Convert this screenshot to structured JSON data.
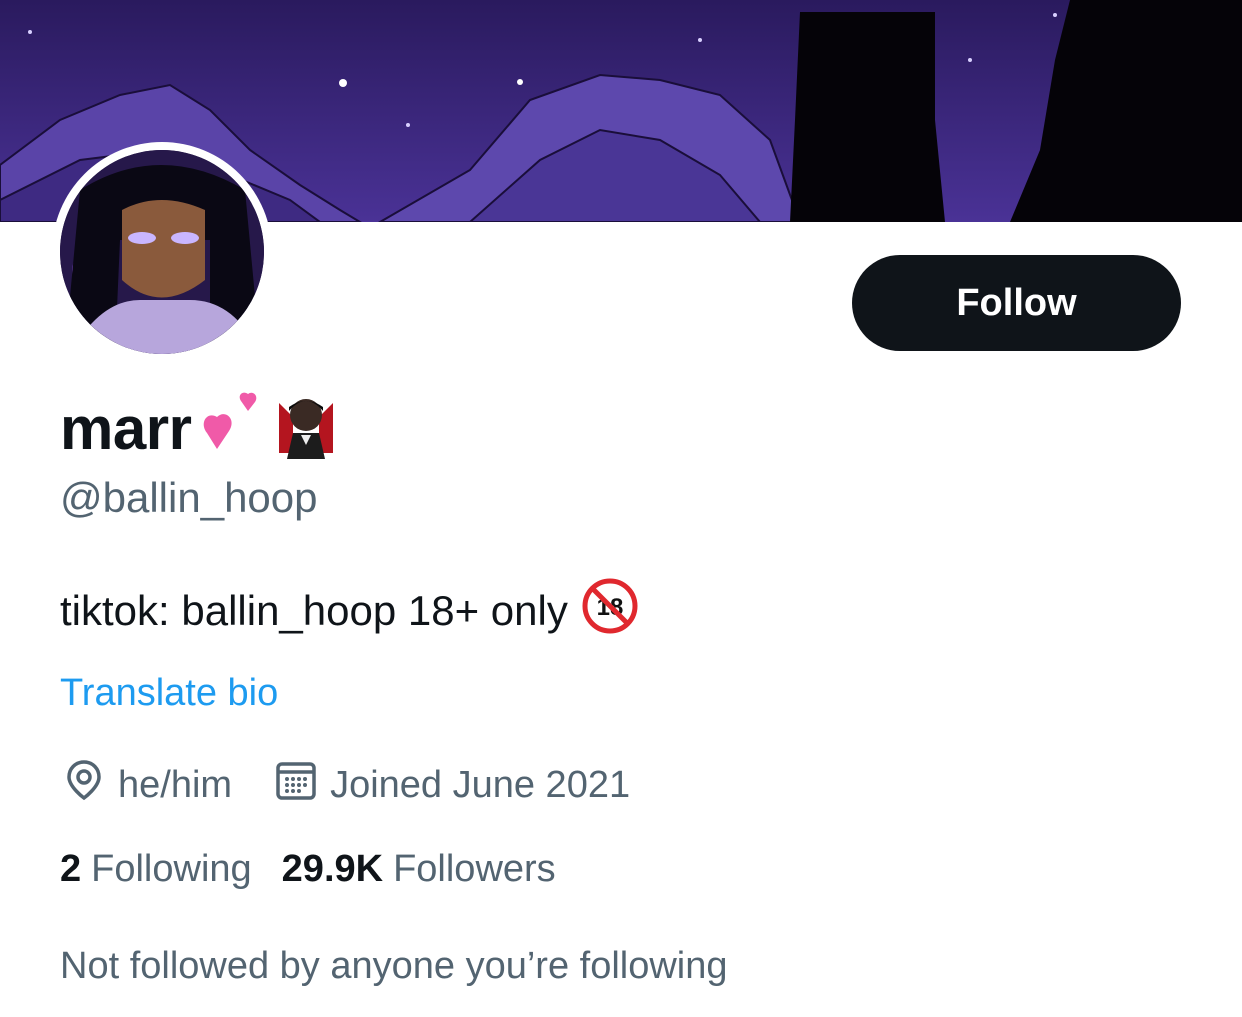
{
  "profile": {
    "display_name": "marr",
    "handle": "@ballin_hoop",
    "bio": "tiktok: ballin_hoop 18+ only",
    "translate_label": "Translate bio",
    "pronouns": "he/him",
    "joined": "Joined June 2021",
    "following_count": "2",
    "following_label": "Following",
    "followers_count": "29.9K",
    "followers_label": "Followers",
    "mutuals_note": "Not followed by anyone you’re following"
  },
  "buttons": {
    "follow_label": "Follow"
  },
  "icons": {
    "name_emojis": [
      "two-hearts-icon",
      "vampire-icon"
    ],
    "bio_emoji": "no-one-under-eighteen-icon",
    "location": "location-pin-icon",
    "calendar": "calendar-icon"
  },
  "colors": {
    "text_primary": "#0f1419",
    "text_secondary": "#536471",
    "link": "#1d9bf0",
    "button_bg": "#0f1419",
    "banner_sky": "#3a2478"
  }
}
